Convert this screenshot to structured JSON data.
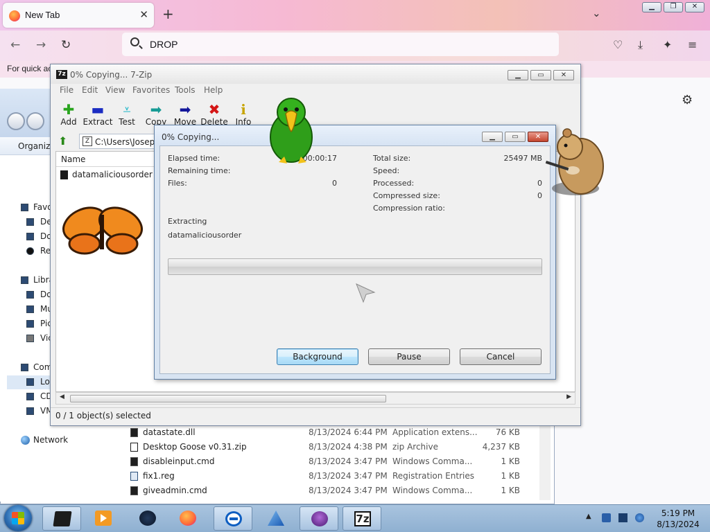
{
  "firefox": {
    "tab_title": "New Tab",
    "tab_close": "✕",
    "new_tab": "+",
    "list_tabs": "⌄",
    "url_text": "DROP",
    "bookmarks_hint": "For quick ac"
  },
  "explorer": {
    "organize": "Organize",
    "nav": {
      "favorites": "Favo",
      "de": "De",
      "do": "Do",
      "re": "Re",
      "libraries": "Libra",
      "do2": "Do",
      "mu": "Mu",
      "pi": "Pic",
      "vi": "Vic",
      "computer": "Com",
      "lo": "Lo",
      "cd": "CD",
      "vm": "VM",
      "network": "Network"
    },
    "files": [
      {
        "name": "datastate.dll",
        "date": "8/13/2024 6:44 PM",
        "type": "Application extens...",
        "size": "76 KB"
      },
      {
        "name": "Desktop Goose v0.31.zip",
        "date": "8/13/2024 4:38 PM",
        "type": "zip Archive",
        "size": "4,237 KB"
      },
      {
        "name": "disableinput.cmd",
        "date": "8/13/2024 3:47 PM",
        "type": "Windows Comma...",
        "size": "1 KB"
      },
      {
        "name": "fix1.reg",
        "date": "8/13/2024 3:47 PM",
        "type": "Registration Entries",
        "size": "1 KB"
      },
      {
        "name": "giveadmin.cmd",
        "date": "8/13/2024 3:47 PM",
        "type": "Windows Comma...",
        "size": "1 KB"
      }
    ]
  },
  "zip": {
    "title": "0% Copying... 7-Zip",
    "menu": [
      "File",
      "Edit",
      "View",
      "Favorites",
      "Tools",
      "Help"
    ],
    "toolbar": [
      "Add",
      "Extract",
      "Test",
      "Copy",
      "Move",
      "Delete",
      "Info"
    ],
    "path": "C:\\Users\\Joseph",
    "column_name": "Name",
    "item": "datamaliciousorder",
    "status": "0 / 1 object(s) selected"
  },
  "dialog": {
    "title": "0% Copying...",
    "elapsed_label": "Elapsed time:",
    "elapsed_value": "00:00:17",
    "remaining_label": "Remaining time:",
    "files_label": "Files:",
    "files_value": "0",
    "total_label": "Total size:",
    "total_value": "25497 MB",
    "speed_label": "Speed:",
    "processed_label": "Processed:",
    "processed_value": "0",
    "compressed_label": "Compressed size:",
    "compressed_value": "0",
    "ratio_label": "Compression ratio:",
    "operation": "Extracting",
    "current_item": "datamaliciousorder",
    "progress": 0,
    "buttons": {
      "background": "Background",
      "pause": "Pause",
      "cancel": "Cancel"
    }
  },
  "taskbar": {
    "time": "5:19 PM",
    "date": "8/13/2024",
    "zip_label": "7z"
  }
}
